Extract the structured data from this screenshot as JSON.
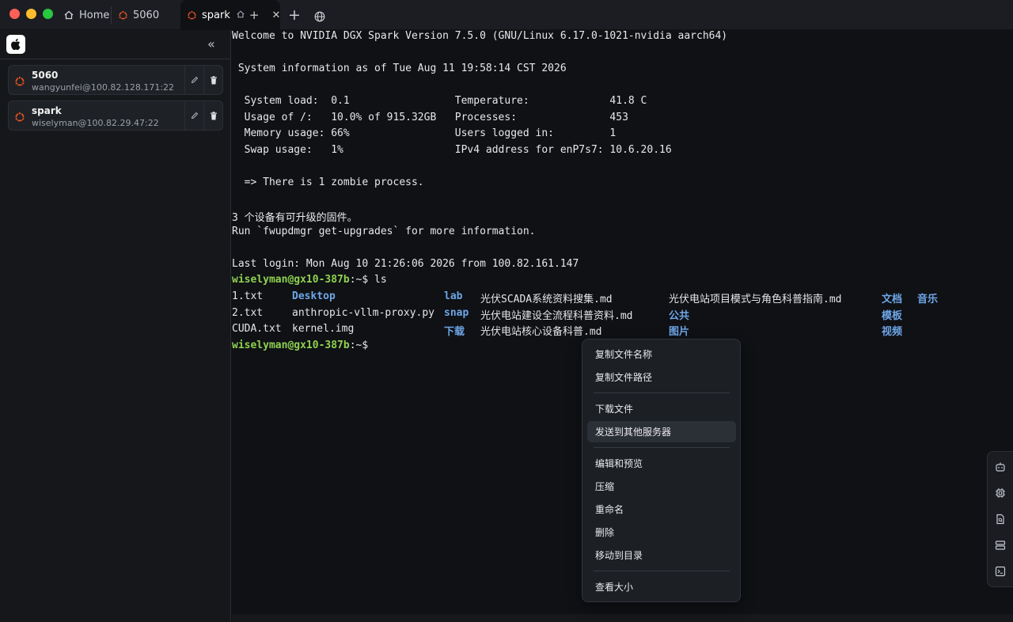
{
  "tabs": {
    "home": "Home",
    "t5060": "5060",
    "spark": "spark"
  },
  "hosts": [
    {
      "name": "5060",
      "address": "wangyunfei@100.82.128.171:22"
    },
    {
      "name": "spark",
      "address": "wiselyman@100.82.29.47:22"
    }
  ],
  "terminal": {
    "lines": [
      "Welcome to NVIDIA DGX Spark Version 7.5.0 (GNU/Linux 6.17.0-1021-nvidia aarch64)",
      " System information as of Tue Aug 11 19:58:14 CST 2026",
      "  System load:  0.1                 Temperature:             41.8 C",
      "  Usage of /:   10.0% of 915.32GB   Processes:               453",
      "  Memory usage: 66%                 Users logged in:         1",
      "  Swap usage:   1%                  IPv4 address for enP7s7: 10.6.20.16",
      "  => There is 1 zombie process.",
      "3 个设备有可升级的固件。",
      "Run `fwupdmgr get-upgrades` for more information.",
      "Last login: Mon Aug 10 21:26:06 2026 from 100.82.161.147"
    ],
    "prompt": "wiselyman@gx10-387b",
    "prompt_suffix": ":~$ ",
    "command": "ls",
    "ls": {
      "r1": [
        "1.txt",
        "Desktop",
        "lab",
        "光伏SCADA系统资料搜集.md",
        "光伏电站项目模式与角色科普指南.md",
        "文档",
        "音乐"
      ],
      "r2": [
        "2.txt",
        "anthropic-vllm-proxy.py",
        "snap",
        "光伏电站建设全流程科普资料.md",
        "公共",
        "模板"
      ],
      "r3": [
        "CUDA.txt",
        "kernel.img",
        "下载",
        "光伏电站核心设备科普.md",
        "图片",
        "视频"
      ]
    }
  },
  "context_menu": {
    "copy_name": "复制文件名称",
    "copy_path": "复制文件路径",
    "download": "下载文件",
    "send_to": "发送到其他服务器",
    "edit_preview": "编辑和预览",
    "compress": "压缩",
    "rename": "重命名",
    "delete": "删除",
    "move": "移动到目录",
    "size": "查看大小"
  },
  "colors": {
    "prompt": "#8fd14f",
    "directory": "#6ea6e6",
    "ubuntu": "#e95420"
  }
}
